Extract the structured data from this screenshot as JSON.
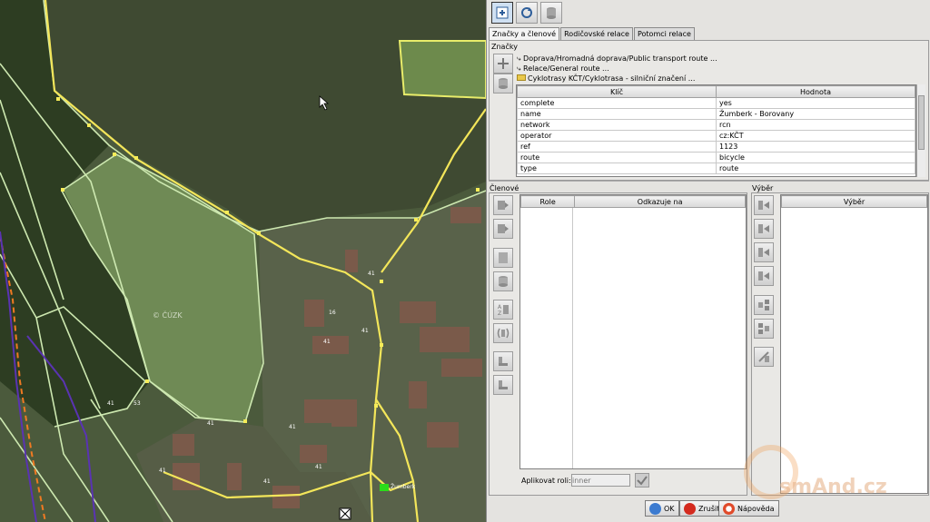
{
  "map": {
    "watermark": "© ČÚZK",
    "house_numbers": [
      "41",
      "41",
      "41",
      "41",
      "41",
      "41",
      "41",
      "41",
      "41",
      "53",
      "16"
    ],
    "place_label": "Žumberk"
  },
  "toolbar": {
    "icons": [
      "relation-editor-icon",
      "refresh-relation-icon",
      "delete-relation-icon"
    ]
  },
  "tabs": [
    "Značky a členové",
    "Rodičovské relace",
    "Potomci relace"
  ],
  "tags_section": {
    "label": "Značky",
    "parent_relations": [
      "Doprava/Hromadná doprava/Public transport route ...",
      "Relace/General route ...",
      "Cyklotrasy KČT/Cyklotrasa - silniční značení ..."
    ],
    "columns": [
      "Klíč",
      "Hodnota"
    ],
    "rows": [
      {
        "key": "complete",
        "value": "yes"
      },
      {
        "key": "name",
        "value": "Žumberk - Borovany"
      },
      {
        "key": "network",
        "value": "rcn"
      },
      {
        "key": "operator",
        "value": "cz:KČT"
      },
      {
        "key": "ref",
        "value": "1123"
      },
      {
        "key": "route",
        "value": "bicycle"
      },
      {
        "key": "type",
        "value": "route"
      }
    ]
  },
  "members_section": {
    "label": "Členové",
    "columns": [
      "Role",
      "Odkazuje na"
    ],
    "apply_role_label": "Aplikovat roli:",
    "role_placeholder": "inner"
  },
  "selection_section": {
    "label": "Výběr",
    "column": "Výběr"
  },
  "buttons": {
    "ok": "OK",
    "cancel": "Zrušit",
    "help": "Nápověda"
  },
  "watermark_text": "smAnd.cz",
  "colors": {
    "boundary": "#cde8b0",
    "road": "#f3e65a",
    "route_purple": "#5a33b3",
    "route_orange": "#f07a22",
    "panel_bg": "#e4e3e0"
  }
}
